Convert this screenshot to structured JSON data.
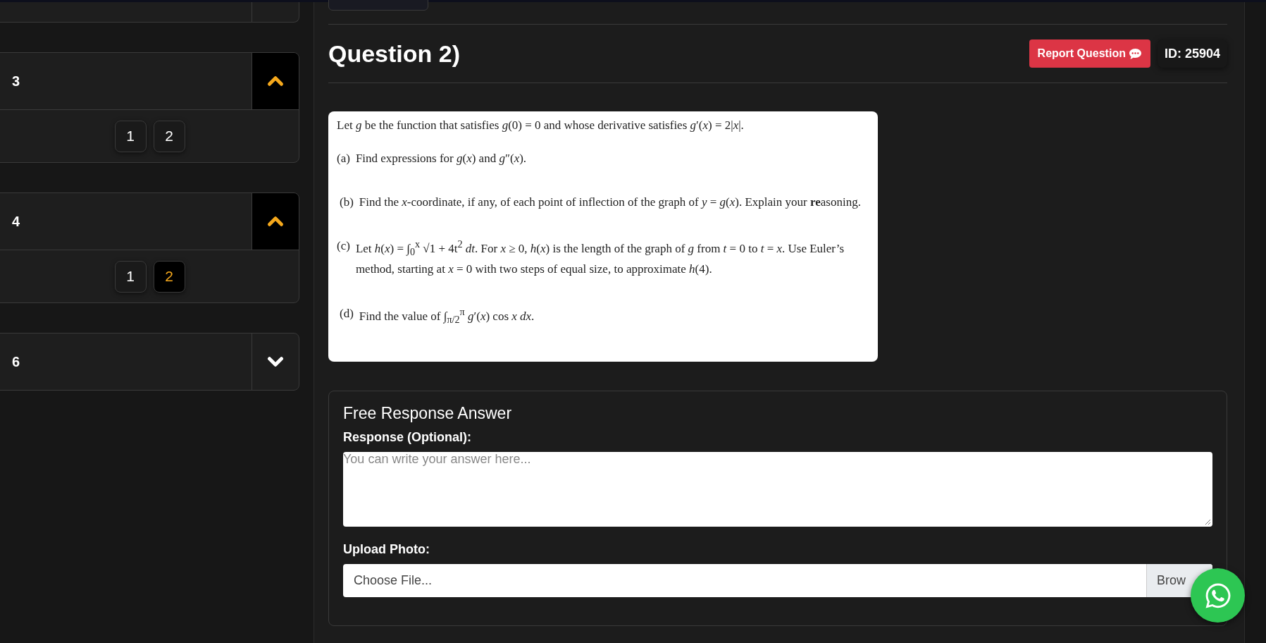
{
  "sidebar": {
    "units": [
      {
        "label": "3",
        "expanded": true,
        "pages": [
          {
            "label": "1",
            "selected": false
          },
          {
            "label": "2",
            "selected": false
          }
        ]
      },
      {
        "label": "4",
        "expanded": true,
        "pages": [
          {
            "label": "1",
            "selected": false
          },
          {
            "label": "2",
            "selected": true
          }
        ]
      },
      {
        "label": "6",
        "expanded": false
      }
    ]
  },
  "question": {
    "title": "Question 2)",
    "report_button": "Report Question",
    "id": "ID: 25904",
    "paragraphs": [
      {
        "kind": "stem",
        "text": "Let *g* be the function that satisfies *g*(0) = 0 and whose derivative satisfies *g*′(*x*) = 2|*x*|."
      },
      {
        "kind": "part",
        "label": "(a)",
        "text": "Find expressions for *g*(*x*) and *g*″(*x*)."
      },
      {
        "kind": "part",
        "label": "(b)",
        "text": "Find the *x*-coordinate, if any, of each point of inflection of the graph of *y* = *g*(*x*). Explain your **re**asoning."
      },
      {
        "kind": "part",
        "label": "(c)",
        "text": "Let *h*(*x*) = ∫$_{0}$$^{x}$ √1 + 4t$^{2}$ *dt*. For *x* ≥ 0, *h*(*x*) is the length of the graph of *g* from *t* = 0 to *t* = *x*. Use Euler’s method, starting at *x* = 0 with two steps of equal size, to approximate *h*(4)."
      },
      {
        "kind": "part",
        "label": "(d)",
        "text": "Find the value of ∫$_{π/2}$$^{π}$ *g*′(*x*) cos *x dx*."
      }
    ]
  },
  "answer": {
    "title": "Free Response Answer",
    "response_label": "Response (Optional):",
    "response_placeholder": "You can write your answer here...",
    "upload_label": "Upload Photo:",
    "file_placeholder": "Choose File...",
    "browse_button": "Brow"
  }
}
